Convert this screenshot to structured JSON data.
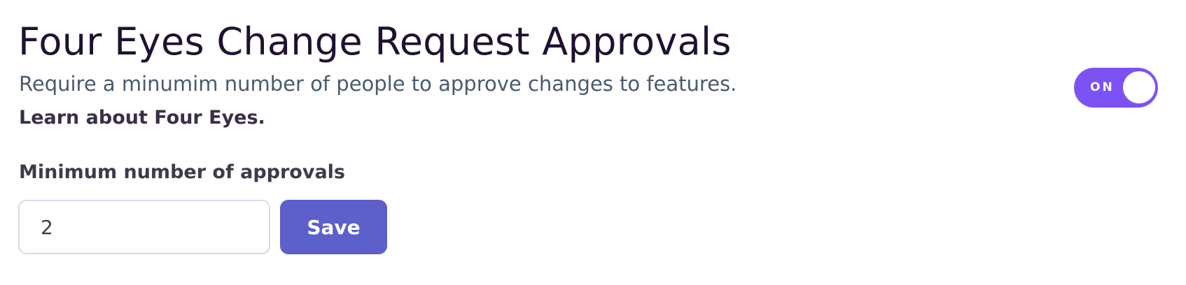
{
  "header": {
    "title": "Four Eyes Change Request Approvals",
    "description": "Require a minumim number of people to approve changes to features.",
    "learn_link": "Learn about Four Eyes."
  },
  "toggle": {
    "label": "ON",
    "checked": true,
    "color": "#7b53f5"
  },
  "approvals": {
    "label": "Minimum number of approvals",
    "value": "2",
    "save_label": "Save",
    "button_color": "#5d5fcb"
  }
}
